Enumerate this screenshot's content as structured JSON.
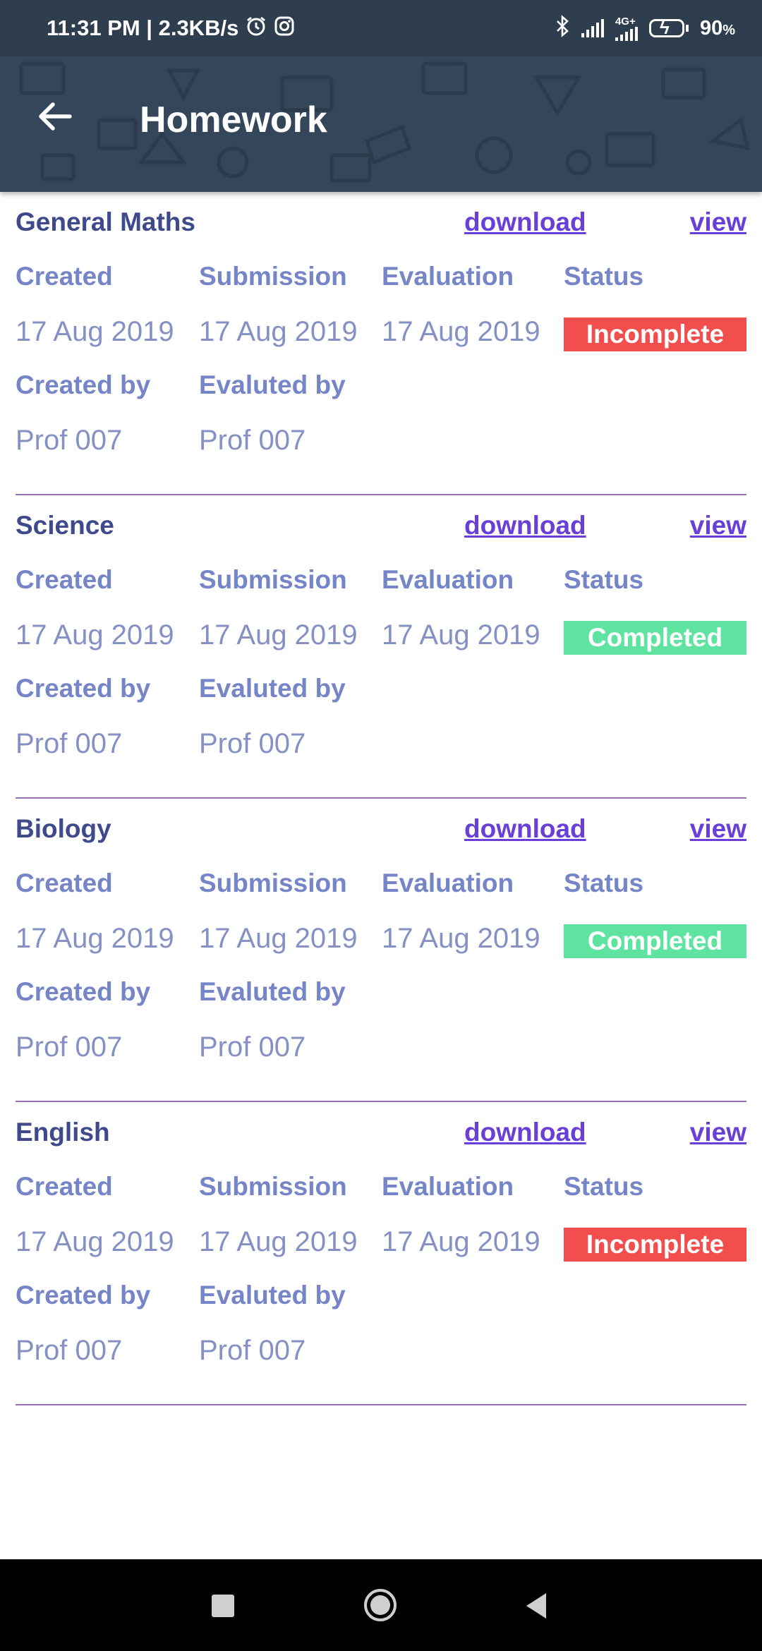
{
  "status_bar": {
    "time_speed": "11:31 PM | 2.3KB/s",
    "network": "4G+",
    "battery": "90",
    "battery_unit": "%"
  },
  "app_bar": {
    "title": "Homework"
  },
  "labels": {
    "download": "download",
    "view": "view",
    "created": "Created",
    "submission": "Submission",
    "evaluation": "Evaluation",
    "status": "Status",
    "created_by": "Created by",
    "evaluated_by": "Evaluted by"
  },
  "homework": [
    {
      "subject": "General Maths",
      "created": "17 Aug 2019",
      "submission": "17 Aug 2019",
      "evaluation": "17 Aug 2019",
      "status": "Incomplete",
      "status_color": "#f24e4e",
      "created_by": "Prof 007",
      "evaluated_by": "Prof 007"
    },
    {
      "subject": "Science",
      "created": "17 Aug 2019",
      "submission": "17 Aug 2019",
      "evaluation": "17 Aug 2019",
      "status": "Completed",
      "status_color": "#5fe3a1",
      "created_by": "Prof 007",
      "evaluated_by": "Prof 007"
    },
    {
      "subject": "Biology",
      "created": "17 Aug 2019",
      "submission": "17 Aug 2019",
      "evaluation": "17 Aug 2019",
      "status": "Completed",
      "status_color": "#5fe3a1",
      "created_by": "Prof 007",
      "evaluated_by": "Prof 007"
    },
    {
      "subject": "English",
      "created": "17 Aug 2019",
      "submission": "17 Aug 2019",
      "evaluation": "17 Aug 2019",
      "status": "Incomplete",
      "status_color": "#f24e4e",
      "created_by": "Prof 007",
      "evaluated_by": "Prof 007"
    }
  ],
  "colors": {
    "app_bar": "#34465a",
    "subject": "#3f4a8c",
    "link": "#6a3fd8",
    "label": "#7585c8",
    "divider": "#9b6fb8"
  },
  "icons": {
    "back": "arrow-left-icon",
    "alarm": "alarm-icon",
    "instagram": "instagram-icon",
    "bluetooth": "bluetooth-icon",
    "battery": "battery-charging-icon"
  }
}
